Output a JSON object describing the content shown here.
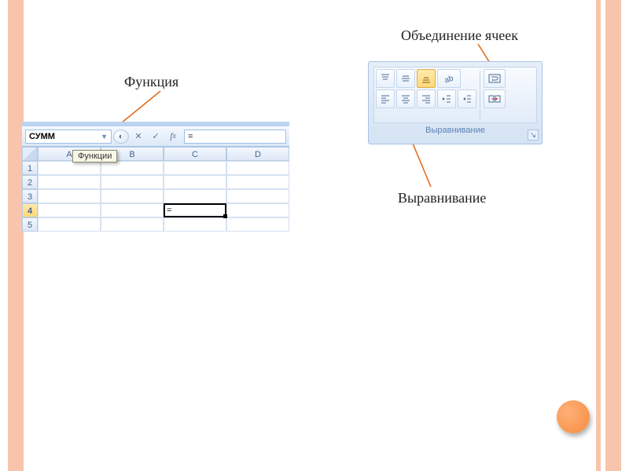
{
  "labels": {
    "merge_cells": "Объединение ячеек",
    "function": "Функция",
    "alignment": "Выравнивание"
  },
  "excel": {
    "namebox_value": "СУММ",
    "tooltip": "Функции",
    "formula_bar_value": "=",
    "col_headers": [
      "A",
      "B",
      "C",
      "D"
    ],
    "row_headers": [
      "1",
      "2",
      "3",
      "4",
      "5"
    ],
    "active_row": "4",
    "active_cell_value": "="
  },
  "ribbon": {
    "group_label": "Выравнивание"
  },
  "icons": {
    "arrow_color": "#e06c1e"
  }
}
